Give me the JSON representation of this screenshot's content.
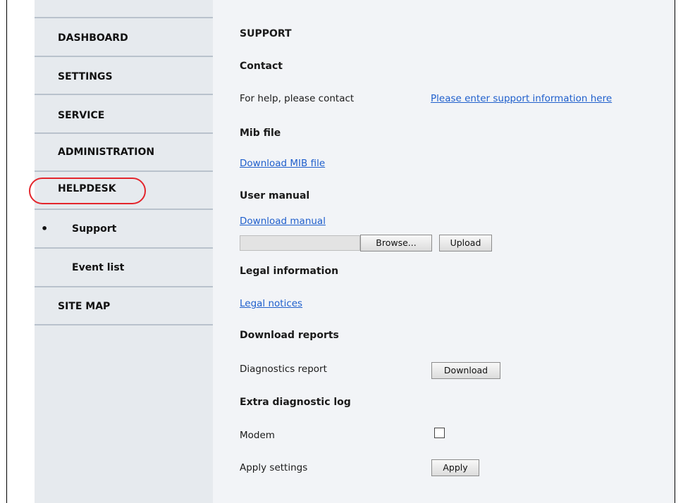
{
  "sidebar": {
    "items": [
      {
        "label": "DASHBOARD"
      },
      {
        "label": "SETTINGS"
      },
      {
        "label": "SERVICE"
      },
      {
        "label": "ADMINISTRATION"
      },
      {
        "label": "HELPDESK",
        "highlighted": true
      },
      {
        "label": "Support",
        "active": true,
        "bullet": "•"
      },
      {
        "label": "Event list"
      },
      {
        "label": "SITE MAP"
      }
    ],
    "highlight_color": "#e3262d"
  },
  "main": {
    "title": "SUPPORT",
    "contact": {
      "heading": "Contact",
      "label": "For help, please contact",
      "link": "Please enter support information here"
    },
    "mib": {
      "heading": "Mib file",
      "link": "Download MIB file"
    },
    "manual": {
      "heading": "User manual",
      "link": "Download manual",
      "browse_label": "Browse...",
      "upload_label": "Upload"
    },
    "legal": {
      "heading": "Legal information",
      "link": "Legal notices"
    },
    "reports": {
      "heading": "Download reports",
      "label": "Diagnostics report",
      "button": "Download"
    },
    "extra_log": {
      "heading": "Extra diagnostic log",
      "modem_label": "Modem",
      "modem_checked": false,
      "apply_label": "Apply settings",
      "apply_button": "Apply"
    }
  }
}
